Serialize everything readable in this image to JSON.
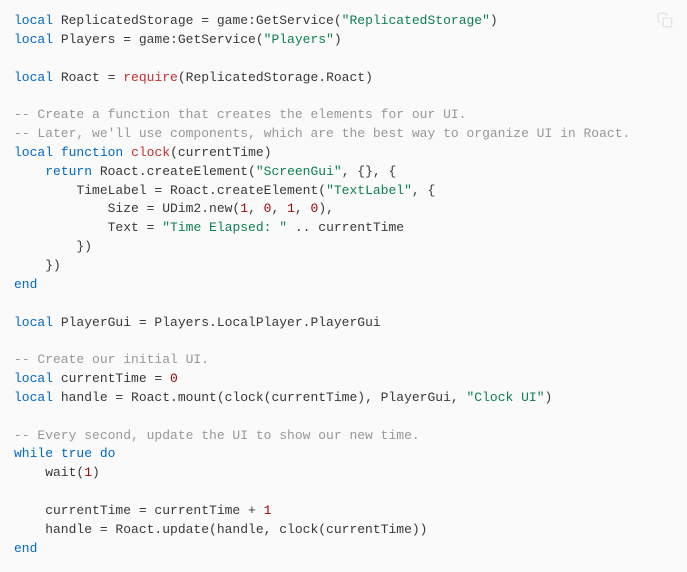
{
  "code": {
    "l1": {
      "kw1": "local",
      "v1": " ReplicatedStorage = game:GetService(",
      "s1": "\"ReplicatedStorage\"",
      "v2": ")"
    },
    "l2": {
      "kw1": "local",
      "v1": " Players = game:GetService(",
      "s1": "\"Players\"",
      "v2": ")"
    },
    "l4": {
      "kw1": "local",
      "v1": " Roact = ",
      "fn1": "require",
      "v2": "(ReplicatedStorage.Roact)"
    },
    "l6": {
      "c1": "-- Create a function that creates the elements for our UI."
    },
    "l7": {
      "c1": "-- Later, we'll use components, which are the best way to organize UI in Roact."
    },
    "l8": {
      "kw1": "local",
      "kw2": "function",
      "fn1": "clock",
      "v1": "(currentTime)"
    },
    "l9": {
      "kw1": "return",
      "v1": " Roact.createElement(",
      "s1": "\"ScreenGui\"",
      "v2": ", {}, {"
    },
    "l10": {
      "v1": "        TimeLabel = Roact.createElement(",
      "s1": "\"TextLabel\"",
      "v2": ", {"
    },
    "l11": {
      "v1": "            Size = UDim2.new(",
      "n1": "1",
      "v2": ", ",
      "n2": "0",
      "v3": ", ",
      "n3": "1",
      "v4": ", ",
      "n4": "0",
      "v5": "),"
    },
    "l12": {
      "v1": "            Text = ",
      "s1": "\"Time Elapsed: \"",
      "v2": " .. currentTime"
    },
    "l13": {
      "v1": "        })"
    },
    "l14": {
      "v1": "    })"
    },
    "l15": {
      "kw1": "end"
    },
    "l17": {
      "kw1": "local",
      "v1": " PlayerGui = Players.LocalPlayer.PlayerGui"
    },
    "l19": {
      "c1": "-- Create our initial UI."
    },
    "l20": {
      "kw1": "local",
      "v1": " currentTime = ",
      "n1": "0"
    },
    "l21": {
      "kw1": "local",
      "v1": " handle = Roact.mount(clock(currentTime), PlayerGui, ",
      "s1": "\"Clock UI\"",
      "v2": ")"
    },
    "l23": {
      "c1": "-- Every second, update the UI to show our new time."
    },
    "l24": {
      "kw1": "while",
      "b1": "true",
      "kw2": "do"
    },
    "l25": {
      "v1": "    wait(",
      "n1": "1",
      "v2": ")"
    },
    "l27": {
      "v1": "    currentTime = currentTime + ",
      "n1": "1"
    },
    "l28": {
      "v1": "    handle = Roact.update(handle, clock(currentTime))"
    },
    "l29": {
      "kw1": "end"
    }
  }
}
